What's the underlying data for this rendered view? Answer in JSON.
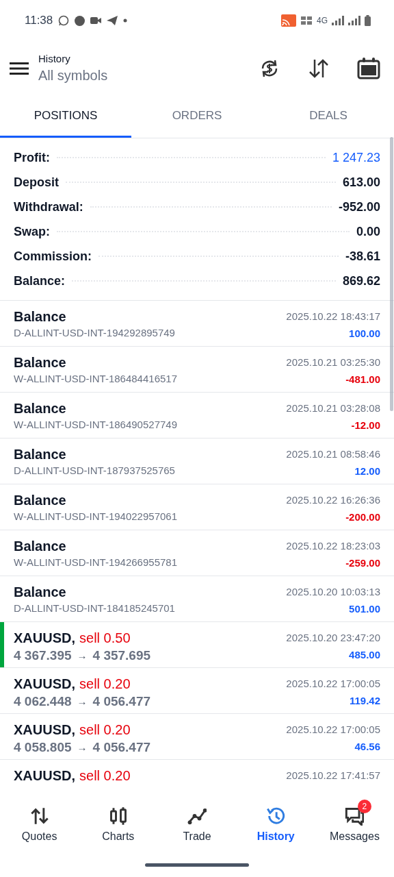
{
  "status_bar": {
    "time": "11:38",
    "network": "4G"
  },
  "header": {
    "title": "History",
    "subtitle": "All symbols"
  },
  "tabs": [
    {
      "label": "POSITIONS",
      "selected": true
    },
    {
      "label": "ORDERS",
      "selected": false
    },
    {
      "label": "DEALS",
      "selected": false
    }
  ],
  "summary": [
    {
      "label": "Profit:",
      "value": "1 247.23",
      "accent": true
    },
    {
      "label": "Deposit",
      "value": "613.00",
      "accent": false
    },
    {
      "label": "Withdrawal:",
      "value": "-952.00",
      "accent": false
    },
    {
      "label": "Swap:",
      "value": "0.00",
      "accent": false
    },
    {
      "label": "Commission:",
      "value": "-38.61",
      "accent": false
    },
    {
      "label": "Balance:",
      "value": "869.62",
      "accent": false
    }
  ],
  "rows": [
    {
      "kind": "balance",
      "title": "Balance",
      "detail": "D-ALLINT-USD-INT-194292895749",
      "time": "2025.10.22 18:43:17",
      "amount": "100.00",
      "loss": false,
      "selected": false
    },
    {
      "kind": "balance",
      "title": "Balance",
      "detail": "W-ALLINT-USD-INT-186484416517",
      "time": "2025.10.21 03:25:30",
      "amount": "-481.00",
      "loss": true,
      "selected": false
    },
    {
      "kind": "balance",
      "title": "Balance",
      "detail": "W-ALLINT-USD-INT-186490527749",
      "time": "2025.10.21 03:28:08",
      "amount": "-12.00",
      "loss": true,
      "selected": false
    },
    {
      "kind": "balance",
      "title": "Balance",
      "detail": "D-ALLINT-USD-INT-187937525765",
      "time": "2025.10.21 08:58:46",
      "amount": "12.00",
      "loss": false,
      "selected": false
    },
    {
      "kind": "balance",
      "title": "Balance",
      "detail": "W-ALLINT-USD-INT-194022957061",
      "time": "2025.10.22 16:26:36",
      "amount": "-200.00",
      "loss": true,
      "selected": false
    },
    {
      "kind": "balance",
      "title": "Balance",
      "detail": "W-ALLINT-USD-INT-194266955781",
      "time": "2025.10.22 18:23:03",
      "amount": "-259.00",
      "loss": true,
      "selected": false
    },
    {
      "kind": "balance",
      "title": "Balance",
      "detail": "D-ALLINT-USD-INT-184185245701",
      "time": "2025.10.20 10:03:13",
      "amount": "501.00",
      "loss": false,
      "selected": false
    },
    {
      "kind": "trade",
      "title": "XAUUSD,",
      "side": "sell 0.50",
      "open": "4 367.395",
      "arrow": "→",
      "close": "4 357.695",
      "time": "2025.10.20 23:47:20",
      "amount": "485.00",
      "loss": false,
      "selected": true
    },
    {
      "kind": "trade",
      "title": "XAUUSD,",
      "side": "sell 0.20",
      "open": "4 062.448",
      "arrow": "→",
      "close": "4 056.477",
      "time": "2025.10.22 17:00:05",
      "amount": "119.42",
      "loss": false,
      "selected": false
    },
    {
      "kind": "trade",
      "title": "XAUUSD,",
      "side": "sell 0.20",
      "open": "4 058.805",
      "arrow": "→",
      "close": "4 056.477",
      "time": "2025.10.22 17:00:05",
      "amount": "46.56",
      "loss": false,
      "selected": false
    },
    {
      "kind": "trade",
      "title": "XAUUSD,",
      "side": "sell 0.20",
      "time": "2025.10.22 17:41:57",
      "selected": false
    }
  ],
  "nav": [
    {
      "label": "Quotes",
      "kind": "quotes",
      "selected": false
    },
    {
      "label": "Charts",
      "kind": "charts",
      "selected": false
    },
    {
      "label": "Trade",
      "kind": "trade",
      "selected": false
    },
    {
      "label": "History",
      "kind": "history",
      "selected": true
    },
    {
      "label": "Messages",
      "kind": "messages",
      "selected": false,
      "badge": "2"
    }
  ]
}
